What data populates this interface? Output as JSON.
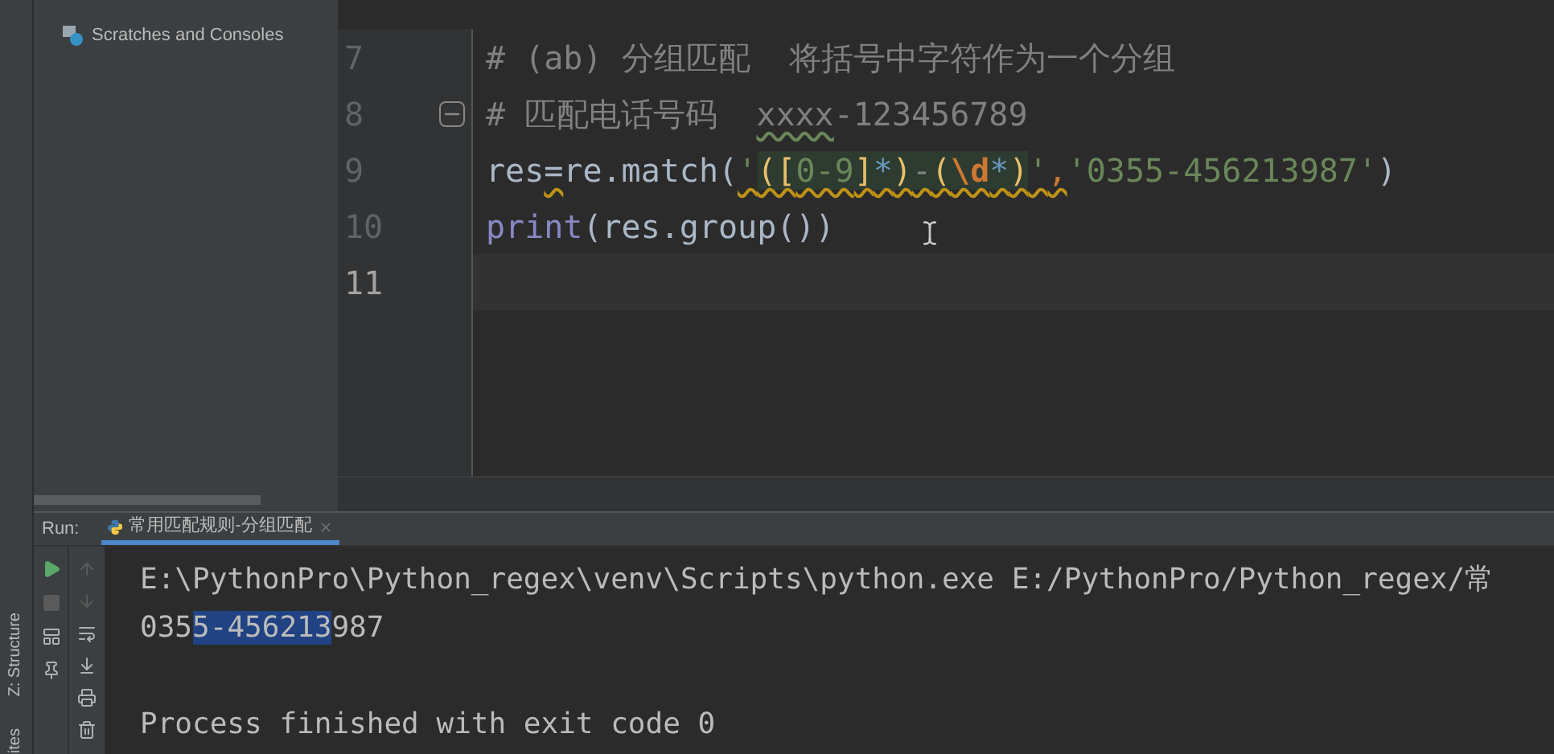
{
  "tool_stripe": [
    "Z: Structure",
    "ites"
  ],
  "project_tree": [
    {
      "label": "Scratches and Consoles",
      "kind": "scratches"
    }
  ],
  "editor": {
    "lines": [
      {
        "number": "7",
        "current": false,
        "tokens": [
          {
            "text": "# (ab) 分组匹配  将括号中字符作为一个分组",
            "kind": "comment"
          }
        ]
      },
      {
        "number": "8",
        "current": false,
        "fold": true,
        "tokens": [
          {
            "text": "# 匹配电话号码  ",
            "kind": "comment"
          },
          {
            "text": "xxxx",
            "kind": "comment",
            "typo": true
          },
          {
            "text": "-123456789",
            "kind": "comment"
          }
        ]
      },
      {
        "number": "9",
        "current": false,
        "tokens": [
          {
            "text": "res",
            "kind": "plain"
          },
          {
            "text": "=",
            "kind": "plain",
            "warning": true
          },
          {
            "text": "re.match(",
            "kind": "plain"
          },
          {
            "text": "'",
            "kind": "string",
            "warning": true
          },
          {
            "text": "([",
            "kind": "regex_group",
            "warning": true,
            "region": true
          },
          {
            "text": "0-9",
            "kind": "regex_range",
            "warning": true,
            "region": true
          },
          {
            "text": "]",
            "kind": "regex_group",
            "warning": true,
            "region": true
          },
          {
            "text": "*",
            "kind": "regex_quant",
            "warning": true,
            "region": true
          },
          {
            "text": ")",
            "kind": "regex_group",
            "warning": true,
            "region": true
          },
          {
            "text": "-",
            "kind": "regex_plain",
            "warning": true,
            "region": true
          },
          {
            "text": "(",
            "kind": "regex_group",
            "warning": true,
            "region": true
          },
          {
            "text": "\\d",
            "kind": "regex_escape",
            "warning": true,
            "region": true
          },
          {
            "text": "*",
            "kind": "regex_quant",
            "warning": true,
            "region": true
          },
          {
            "text": ")",
            "kind": "regex_group",
            "warning": true,
            "region": true
          },
          {
            "text": "'",
            "kind": "string",
            "warning": true
          },
          {
            "text": ",",
            "kind": "comma",
            "warning": true
          },
          {
            "text": "'0355-456213987'",
            "kind": "string"
          },
          {
            "text": ")",
            "kind": "plain"
          }
        ]
      },
      {
        "number": "10",
        "current": false,
        "tokens": [
          {
            "text": "print",
            "kind": "builtin"
          },
          {
            "text": "(res.group())",
            "kind": "plain"
          }
        ]
      },
      {
        "number": "11",
        "current": true
      }
    ]
  },
  "run_panel": {
    "label": "Run:",
    "tabs": [
      {
        "title": "常用匹配规则-分组匹配",
        "selected": true
      }
    ],
    "console": [
      {
        "kind": "command",
        "segments": [
          {
            "text": "E:\\PythonPro\\Python_regex\\venv\\Scripts\\python.exe E:/PythonPro/Python_regex/常",
            "selected": false
          }
        ]
      },
      {
        "kind": "output",
        "segments": [
          {
            "text": "035",
            "selected": false
          },
          {
            "text": "5-456213",
            "selected": true
          },
          {
            "text": "987",
            "selected": false
          }
        ]
      },
      {
        "kind": "exit",
        "segments": [
          {
            "text": "Process finished with exit code 0",
            "selected": false
          }
        ]
      }
    ]
  }
}
